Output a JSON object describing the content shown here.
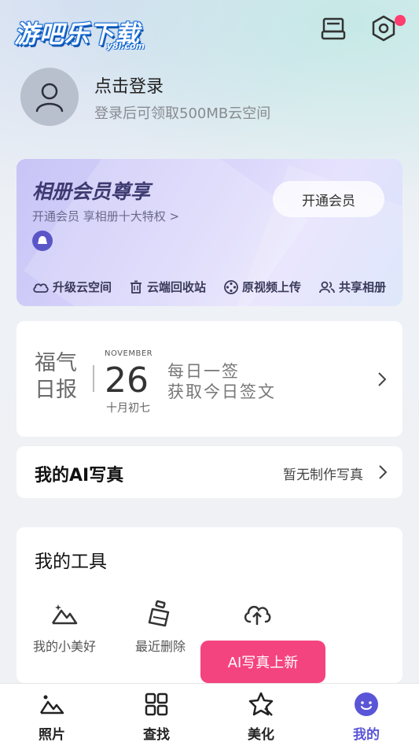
{
  "app": {
    "logo_main": "游吧乐下载",
    "logo_sub": "y8l.com"
  },
  "profile": {
    "login_title": "点击登录",
    "login_subtitle": "登录后可领取500MB云空间"
  },
  "vip": {
    "title": "相册会员尊享",
    "subtitle": "开通会员 享相册十大特权 >",
    "button": "开通会员",
    "features": [
      {
        "label": "升级云空间",
        "icon": "cloud-icon"
      },
      {
        "label": "云端回收站",
        "icon": "trash-icon"
      },
      {
        "label": "原视频上传",
        "icon": "film-reel-icon"
      },
      {
        "label": "共享相册",
        "icon": "people-icon"
      }
    ]
  },
  "fortune": {
    "title_line1": "福气",
    "title_line2": "日报",
    "month": "NOVEMBER",
    "day": "26",
    "lunar": "十月初七",
    "line1": "每日一签",
    "line2": "获取今日签文"
  },
  "ai_photo": {
    "title": "我的AI写真",
    "status": "暂无制作写真"
  },
  "tools": {
    "title": "我的工具",
    "items": [
      {
        "label": "我的小美好",
        "icon": "mountain-sparkle-icon"
      },
      {
        "label": "最近删除",
        "icon": "broom-icon"
      },
      {
        "label": "",
        "icon": "cloud-upload-icon"
      }
    ]
  },
  "bubble": {
    "text": "AI写真上新"
  },
  "tabbar": {
    "tabs": [
      {
        "label": "照片",
        "icon": "photos-icon",
        "active": false
      },
      {
        "label": "查找",
        "icon": "grid-icon",
        "active": false
      },
      {
        "label": "美化",
        "icon": "star-edit-icon",
        "active": false
      },
      {
        "label": "我的",
        "icon": "profile-face-icon",
        "active": true
      }
    ]
  },
  "colors": {
    "accent": "#5a55d6",
    "bubble": "#f4447f",
    "notification_dot": "#ff3d6e"
  }
}
